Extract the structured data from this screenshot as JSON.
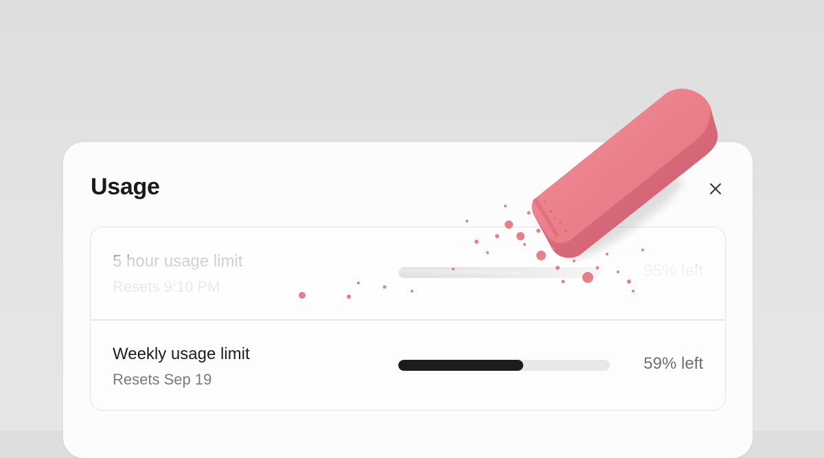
{
  "dialog": {
    "title": "Usage",
    "close_icon": "close-icon"
  },
  "limits": [
    {
      "title": "5 hour usage limit",
      "reset": "Resets 9:10 PM",
      "remaining_percent": 95,
      "remaining_label": "95% left",
      "state": "erased"
    },
    {
      "title": "Weekly usage limit",
      "reset": "Resets Sep 19",
      "remaining_percent": 59,
      "remaining_label": "59% left",
      "state": "normal"
    }
  ],
  "colors": {
    "progress_fill": "#1c1c1c",
    "progress_track": "#e8e8e8",
    "eraser": "#e77f8a",
    "background": "#e0e0e0",
    "panel": "#fcfcfc"
  }
}
